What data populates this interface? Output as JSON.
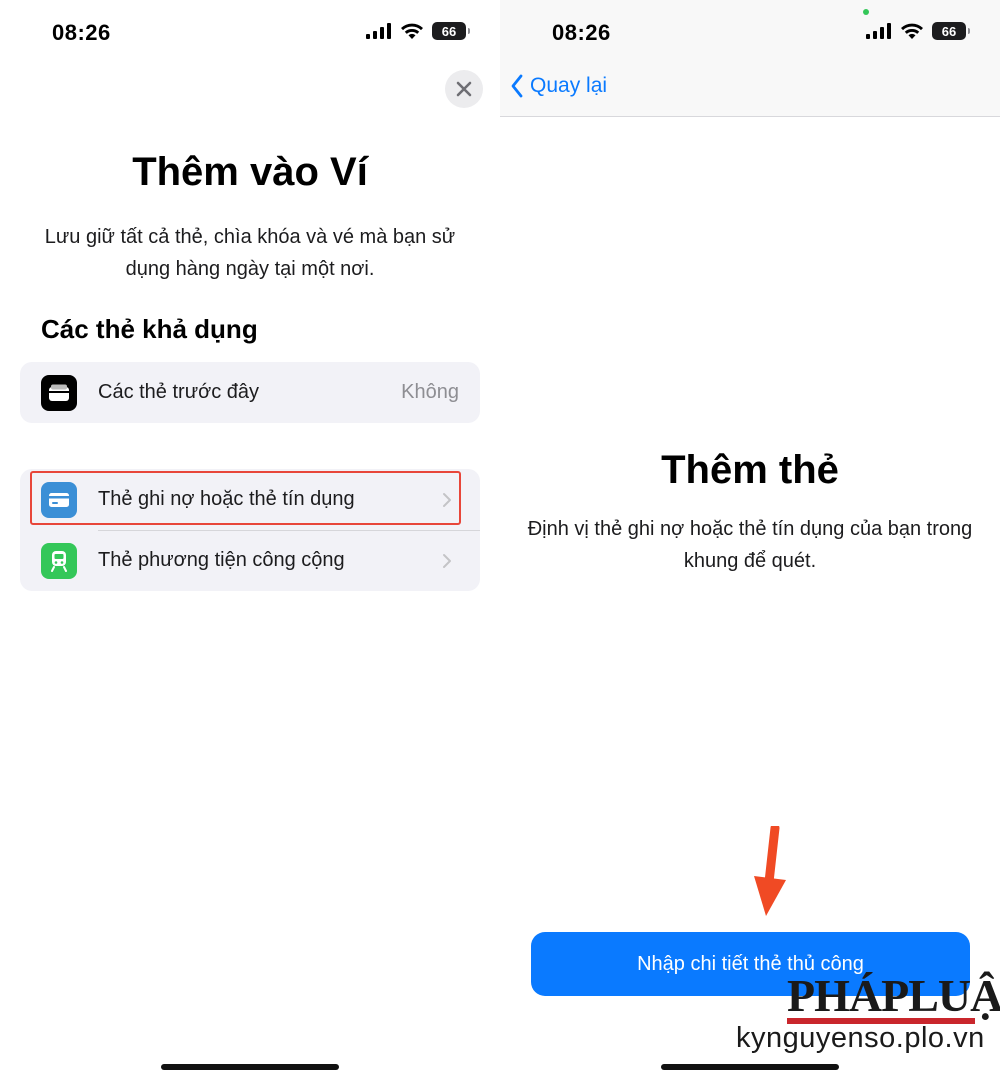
{
  "left": {
    "status": {
      "time": "08:26",
      "battery": "66"
    },
    "title": "Thêm vào Ví",
    "subtitle": "Lưu giữ tất cả thẻ, chìa khóa và vé mà bạn sử dụng hàng ngày tại một nơi.",
    "section_heading": "Các thẻ khả dụng",
    "previous_cards": {
      "label": "Các thẻ trước đây",
      "value": "Không"
    },
    "card_types": [
      {
        "label": "Thẻ ghi nợ hoặc thẻ tín dụng",
        "icon": "credit-card-icon",
        "color": "#3b8fd6"
      },
      {
        "label": "Thẻ phương tiện công cộng",
        "icon": "train-icon",
        "color": "#34c759"
      }
    ]
  },
  "right": {
    "status": {
      "time": "08:26",
      "battery": "66"
    },
    "back_label": "Quay lại",
    "title": "Thêm thẻ",
    "subtitle": "Định vị thẻ ghi nợ hoặc thẻ tín dụng của bạn trong khung để quét.",
    "primary_button": "Nhập chi tiết thẻ thủ công"
  },
  "watermark": {
    "logo": "PHÁPLUẬT",
    "url": "kynguyenso.plo.vn"
  },
  "colors": {
    "accent": "#0a7aff",
    "highlight": "#e8463a",
    "arrow": "#f04a24"
  }
}
